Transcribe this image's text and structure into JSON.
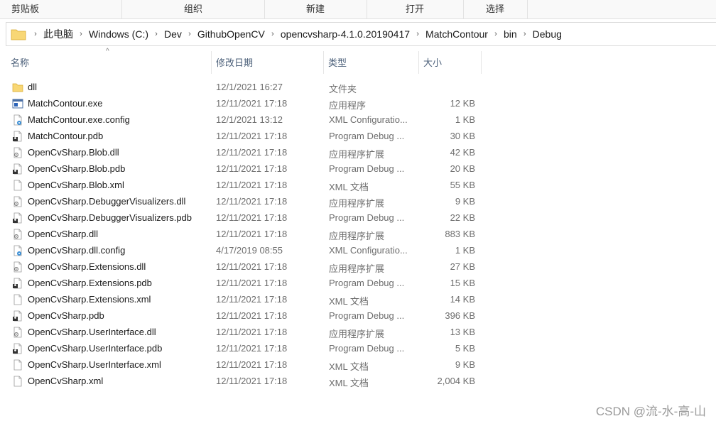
{
  "ribbon": {
    "clipboard": "剪贴板",
    "organize": "组织",
    "new": "新建",
    "open": "打开",
    "select": "选择"
  },
  "breadcrumb": [
    "此电脑",
    "Windows (C:)",
    "Dev",
    "GithubOpenCV",
    "opencvsharp-4.1.0.20190417",
    "MatchContour",
    "bin",
    "Debug"
  ],
  "columns": {
    "name": "名称",
    "date": "修改日期",
    "type": "类型",
    "size": "大小"
  },
  "files": [
    {
      "name": "dll",
      "date": "12/1/2021 16:27",
      "type": "文件夹",
      "size": "",
      "icon": "folder-icon"
    },
    {
      "name": "MatchContour.exe",
      "date": "12/11/2021 17:18",
      "type": "应用程序",
      "size": "12 KB",
      "icon": "exe-icon"
    },
    {
      "name": "MatchContour.exe.config",
      "date": "12/1/2021 13:12",
      "type": "XML Configuratio...",
      "size": "1 KB",
      "icon": "config-icon"
    },
    {
      "name": "MatchContour.pdb",
      "date": "12/11/2021 17:18",
      "type": "Program Debug ...",
      "size": "30 KB",
      "icon": "pdb-icon"
    },
    {
      "name": "OpenCvSharp.Blob.dll",
      "date": "12/11/2021 17:18",
      "type": "应用程序扩展",
      "size": "42 KB",
      "icon": "dll-icon"
    },
    {
      "name": "OpenCvSharp.Blob.pdb",
      "date": "12/11/2021 17:18",
      "type": "Program Debug ...",
      "size": "20 KB",
      "icon": "pdb-icon"
    },
    {
      "name": "OpenCvSharp.Blob.xml",
      "date": "12/11/2021 17:18",
      "type": "XML 文档",
      "size": "55 KB",
      "icon": "xml-icon"
    },
    {
      "name": "OpenCvSharp.DebuggerVisualizers.dll",
      "date": "12/11/2021 17:18",
      "type": "应用程序扩展",
      "size": "9 KB",
      "icon": "dll-icon"
    },
    {
      "name": "OpenCvSharp.DebuggerVisualizers.pdb",
      "date": "12/11/2021 17:18",
      "type": "Program Debug ...",
      "size": "22 KB",
      "icon": "pdb-icon"
    },
    {
      "name": "OpenCvSharp.dll",
      "date": "12/11/2021 17:18",
      "type": "应用程序扩展",
      "size": "883 KB",
      "icon": "dll-icon"
    },
    {
      "name": "OpenCvSharp.dll.config",
      "date": "4/17/2019 08:55",
      "type": "XML Configuratio...",
      "size": "1 KB",
      "icon": "config-icon"
    },
    {
      "name": "OpenCvSharp.Extensions.dll",
      "date": "12/11/2021 17:18",
      "type": "应用程序扩展",
      "size": "27 KB",
      "icon": "dll-icon"
    },
    {
      "name": "OpenCvSharp.Extensions.pdb",
      "date": "12/11/2021 17:18",
      "type": "Program Debug ...",
      "size": "15 KB",
      "icon": "pdb-icon"
    },
    {
      "name": "OpenCvSharp.Extensions.xml",
      "date": "12/11/2021 17:18",
      "type": "XML 文档",
      "size": "14 KB",
      "icon": "xml-icon"
    },
    {
      "name": "OpenCvSharp.pdb",
      "date": "12/11/2021 17:18",
      "type": "Program Debug ...",
      "size": "396 KB",
      "icon": "pdb-icon"
    },
    {
      "name": "OpenCvSharp.UserInterface.dll",
      "date": "12/11/2021 17:18",
      "type": "应用程序扩展",
      "size": "13 KB",
      "icon": "dll-icon"
    },
    {
      "name": "OpenCvSharp.UserInterface.pdb",
      "date": "12/11/2021 17:18",
      "type": "Program Debug ...",
      "size": "5 KB",
      "icon": "pdb-icon"
    },
    {
      "name": "OpenCvSharp.UserInterface.xml",
      "date": "12/11/2021 17:18",
      "type": "XML 文档",
      "size": "9 KB",
      "icon": "xml-icon"
    },
    {
      "name": "OpenCvSharp.xml",
      "date": "12/11/2021 17:18",
      "type": "XML 文档",
      "size": "2,004 KB",
      "icon": "xml-icon"
    }
  ],
  "watermark": "CSDN @流-水-高-山",
  "colors": {
    "folder": "#f8d775",
    "header_text": "#4c607a",
    "secondary_text": "#6d6d6d"
  }
}
